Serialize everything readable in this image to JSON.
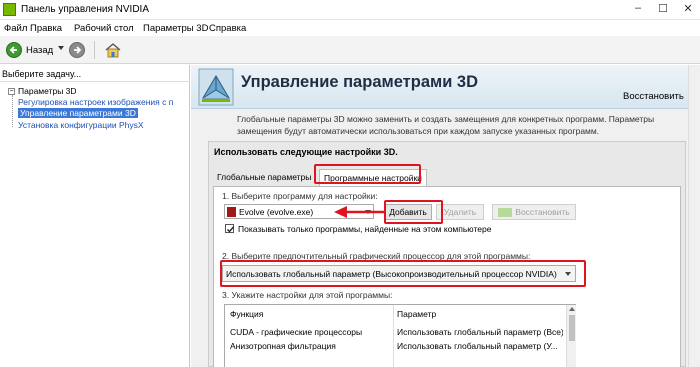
{
  "window": {
    "title": "Панель управления NVIDIA",
    "min": "–",
    "max": "☐",
    "close": "✕"
  },
  "menu": [
    "Файл",
    "Правка",
    "Рабочий стол",
    "Параметры 3D",
    "Справка"
  ],
  "toolbar": {
    "back_label": "Назад"
  },
  "sidebar": {
    "header": "Выберите задачу...",
    "root": "Параметры 3D",
    "items": [
      {
        "label": "Регулировка настроек изображения с п",
        "selected": false
      },
      {
        "label": "Управление параметрами 3D",
        "selected": true
      },
      {
        "label": "Установка конфигурации PhysX",
        "selected": false
      }
    ]
  },
  "main": {
    "title": "Управление параметрами 3D",
    "restore": "Восстановить",
    "description": "Глобальные параметры 3D можно заменить и создать замещения для конкретных программ. Параметры замещения будут автоматически использоваться при каждом запуске указанных программ.",
    "group_title": "Использовать следующие настройки 3D.",
    "tabs": [
      "Глобальные параметры",
      "Программные настройки"
    ],
    "step1": "1. Выберите программу для настройки:",
    "program": "Evolve (evolve.exe)",
    "buttons": {
      "add": "Добавить",
      "remove": "Удалить",
      "restore": "Восстановить"
    },
    "checkbox_label": "Показывать только программы, найденные на этом компьютере",
    "step2": "2. Выберите предпочтительный графический процессор для этой программы:",
    "gpu": "Использовать глобальный параметр (Высокопроизводительный процессор NVIDIA)",
    "step3": "3. Укажите настройки для этой программы:",
    "table": {
      "headers": [
        "Функция",
        "Параметр"
      ],
      "rows": [
        [
          "CUDA - графические процессоры",
          "Использовать глобальный параметр (Все)"
        ],
        [
          "Анизотропная фильтрация",
          "Использовать глобальный параметр (У..."
        ]
      ]
    }
  },
  "colors": {
    "annotation": "#e0141e",
    "selection": "#3b78d8",
    "nvidia_green": "#76b900"
  }
}
